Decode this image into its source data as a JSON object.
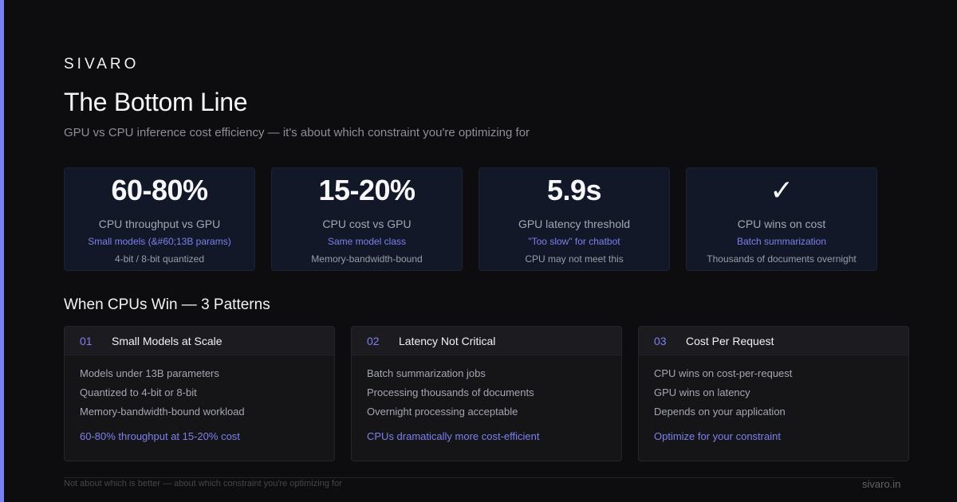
{
  "brand": "SIVARO",
  "title": "The Bottom Line",
  "subtitle": "GPU vs CPU inference cost efficiency — it's about which constraint you're optimizing for",
  "colors": {
    "accent": "#7b7ff6",
    "background": "#0d0d0f",
    "stat_card": "#121827",
    "pattern_card": "#151518"
  },
  "stats": [
    {
      "value": "60-80%",
      "label": "CPU throughput vs GPU",
      "note": "Small models (&#60;13B params)",
      "detail": "4-bit / 8-bit quantized"
    },
    {
      "value": "15-20%",
      "label": "CPU cost vs GPU",
      "note": "Same model class",
      "detail": "Memory-bandwidth-bound"
    },
    {
      "value": "5.9s",
      "label": "GPU latency threshold",
      "note": "\"Too slow\" for chatbot",
      "detail": "CPU may not meet this"
    },
    {
      "value": "✓",
      "icon": "checkmark-icon",
      "label": "CPU wins on cost",
      "note": "Batch summarization",
      "detail": "Thousands of documents overnight"
    }
  ],
  "section_title": "When CPUs Win — 3 Patterns",
  "patterns": [
    {
      "num": "01",
      "title": "Small Models at Scale",
      "items": [
        "Models under 13B parameters",
        "Quantized to 4-bit or 8-bit",
        "Memory-bandwidth-bound workload"
      ],
      "takeaway": "60-80% throughput at 15-20% cost"
    },
    {
      "num": "02",
      "title": "Latency Not Critical",
      "items": [
        "Batch summarization jobs",
        "Processing thousands of documents",
        "Overnight processing acceptable"
      ],
      "takeaway": "CPUs dramatically more cost-efficient"
    },
    {
      "num": "03",
      "title": "Cost Per Request",
      "items": [
        "CPU wins on cost-per-request",
        "GPU wins on latency",
        "Depends on your application"
      ],
      "takeaway": "Optimize for your constraint"
    }
  ],
  "footer": {
    "note": "Not about which is better — about which constraint you're optimizing for",
    "site": "sivaro.in"
  }
}
